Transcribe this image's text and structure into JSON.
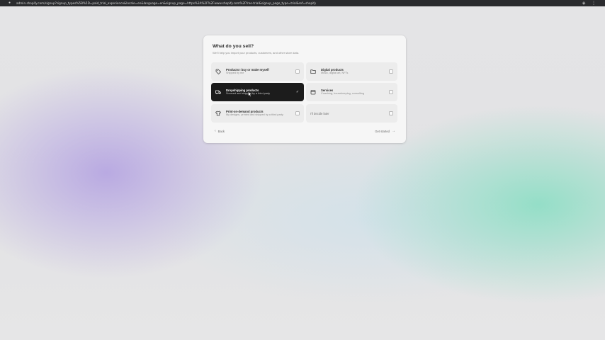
{
  "browser": {
    "url": "admin.shopify.com/signup?signup_types%5B%5D=paid_trial_experience&locale=en&language=en&signup_page=https%3A%2F%2Fwww.shopify.com%2Ffree-trial&signup_page_type=trial&ref=shopify",
    "lock_icon": "lock-icon",
    "extensions_icon": "puzzle-icon",
    "menu_icon": "more-vertical-icon"
  },
  "dialog": {
    "title": "What do you sell?",
    "subtitle": "We'll help you import your products, customers, and other store data.",
    "options": [
      {
        "icon": "tag-icon",
        "title": "Products I buy or make myself",
        "description": "Shipped by me",
        "selected": false
      },
      {
        "icon": "folder-icon",
        "title": "Digital products",
        "description": "Music, digital art, NFTs",
        "selected": false
      },
      {
        "icon": "truck-icon",
        "title": "Dropshipping products",
        "description": "Sourced and shipped by a third party",
        "selected": true
      },
      {
        "icon": "calendar-icon",
        "title": "Services",
        "description": "Coaching, housekeeping, consulting",
        "selected": false
      },
      {
        "icon": "shirt-icon",
        "title": "Print-on-demand products",
        "description": "My designs, printed and shipped by a third party",
        "selected": false
      },
      {
        "icon": "",
        "title": "I'll decide later",
        "description": "",
        "selected": false
      }
    ],
    "back_label": "Back",
    "next_label": "Get started"
  },
  "colors": {
    "selected_bg": "#1c1c1c",
    "option_bg": "#ececec",
    "card_bg": "#f6f6f6"
  }
}
